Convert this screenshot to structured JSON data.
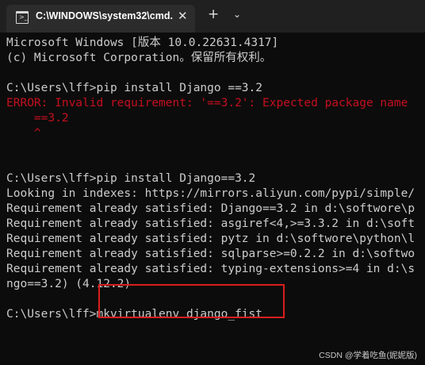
{
  "window": {
    "tab_title": "C:\\WINDOWS\\system32\\cmd.",
    "close_icon": "close-icon",
    "new_tab_icon": "plus-icon",
    "dropdown_icon": "chevron-down-icon",
    "tab_icon": "terminal-icon"
  },
  "console": {
    "lines": [
      "Microsoft Windows [版本 10.0.22631.4317]",
      "(c) Microsoft Corporation。保留所有权利。",
      "",
      "C:\\Users\\lff>pip install Django ==3.2",
      "ERROR: Invalid requirement: '==3.2': Expected package name",
      "    ==3.2",
      "    ^",
      "",
      "",
      "C:\\Users\\lff>pip install Django==3.2",
      "Looking in indexes: https://mirrors.aliyun.com/pypi/simple/",
      "Requirement already satisfied: Django==3.2 in d:\\softwore\\p",
      "Requirement already satisfied: asgiref<4,>=3.3.2 in d:\\soft",
      "Requirement already satisfied: pytz in d:\\softwore\\python\\l",
      "Requirement already satisfied: sqlparse>=0.2.2 in d:\\softwo",
      "Requirement already satisfied: typing-extensions>=4 in d:\\s",
      "ngo==3.2) (4.12.2)",
      "",
      "C:\\Users\\lff>mkvirtualenv django_fist"
    ]
  },
  "colors": {
    "background": "#0c0c0c",
    "text": "#cccccc",
    "error": "#c50f1f",
    "highlight_box": "#d81e1e"
  },
  "watermark": "CSDN @学着吃鱼(妮妮版)"
}
